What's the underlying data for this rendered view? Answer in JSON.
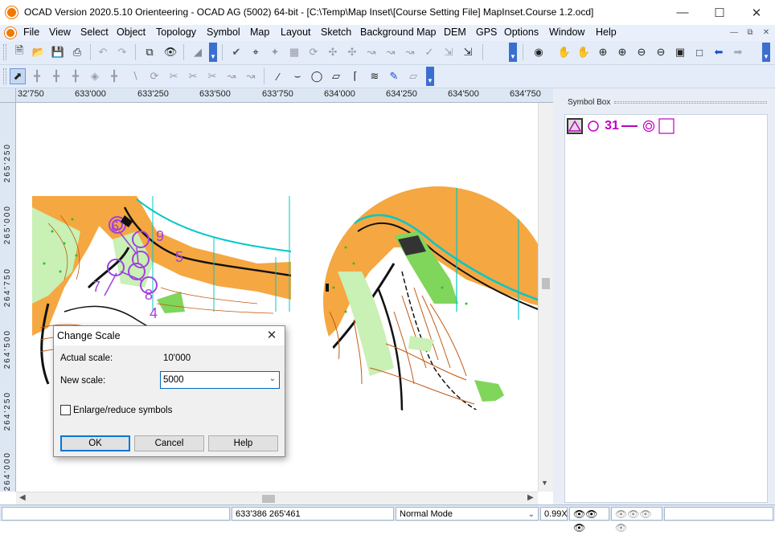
{
  "window": {
    "title": "OCAD Version 2020.5.10 Orienteering - OCAD AG (5002) 64-bit - [C:\\Temp\\Map Inset\\[Course Setting File] MapInset.Course 1.2.ocd]",
    "minimize_icon": "minimize-icon",
    "maximize_icon": "maximize-icon",
    "close_icon": "close-icon"
  },
  "menubar": {
    "items": [
      "File",
      "View",
      "Select",
      "Object",
      "Topology",
      "Symbol",
      "Map",
      "Layout",
      "Sketch",
      "Background Map",
      "DEM",
      "GPS",
      "Options",
      "Window",
      "Help"
    ]
  },
  "hruler": {
    "ticks": [
      "32'750",
      "633'000",
      "633'250",
      "633'500",
      "633'750",
      "634'000",
      "634'250",
      "634'500",
      "634'750"
    ]
  },
  "vruler": {
    "ticks": [
      "265'250",
      "265'000",
      "264'750",
      "264'500",
      "264'250",
      "264'000"
    ]
  },
  "map": {
    "control_numbers": [
      "6",
      "9",
      "5",
      "7",
      "8",
      "4"
    ],
    "colors": {
      "orange": "#f5a742",
      "green": "#7fd65a",
      "light_green": "#c9f0b5",
      "brown": "#c05a12",
      "black": "#111111",
      "purple": "#a040e0",
      "cyan": "#00c8c8"
    }
  },
  "symbol_box": {
    "header": "Symbol Box",
    "symbols": [
      "start-triangle",
      "control-circle",
      "control-number",
      "course-line",
      "finish-circle",
      "map-exchange-square"
    ],
    "number_label": "31"
  },
  "status": {
    "coords": "633'386   265'461",
    "mode": "Normal Mode",
    "zoom": "0.99X"
  },
  "dialog": {
    "title": "Change Scale",
    "actual_label": "Actual scale:",
    "actual_value": "10'000",
    "new_label": "New scale:",
    "new_value": "5000",
    "checkbox_label": "Enlarge/reduce symbols",
    "checkbox_checked": false,
    "ok": "OK",
    "cancel": "Cancel",
    "help": "Help"
  }
}
